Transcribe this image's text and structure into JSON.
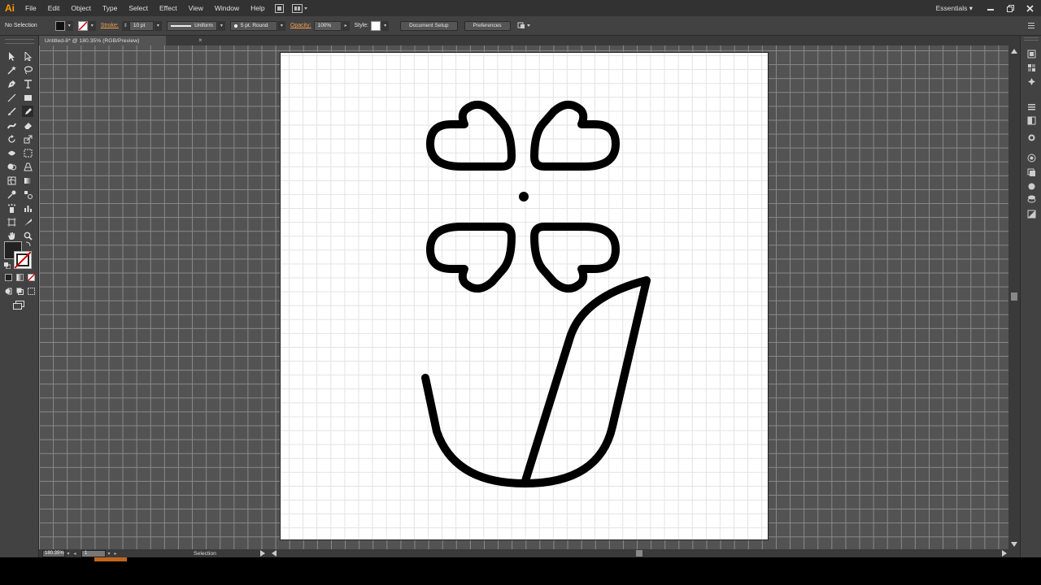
{
  "app": {
    "logo": "Ai",
    "accent": "#ff9a00"
  },
  "menu": [
    "File",
    "Edit",
    "Object",
    "Type",
    "Select",
    "Effect",
    "View",
    "Window",
    "Help"
  ],
  "menu_icons": [
    "bridge-icon",
    "arrange-documents-icon"
  ],
  "workspace": {
    "label": "Essentials",
    "arrow": "▾"
  },
  "window_controls": [
    "minimize-icon",
    "restore-icon",
    "close-icon"
  ],
  "control": {
    "selection_label": "No Selection",
    "stroke_label": "Stroke:",
    "stroke_weight": "10 pt",
    "stroke_profile": "Uniform",
    "brush": "5 pt. Round",
    "opacity_label": "Opacity:",
    "opacity_value": "100%",
    "style_label": "Style:",
    "document_setup": "Document Setup",
    "preferences": "Preferences",
    "link_color": "#f0a050"
  },
  "document": {
    "tab_title": "Untitled-8* @ 180.35% (RGB/Preview)",
    "tab_close": "×"
  },
  "tools": [
    "selection-tool-icon",
    "direct-selection-tool-icon",
    "magic-wand-tool-icon",
    "lasso-tool-icon",
    "pen-tool-icon",
    "type-tool-icon",
    "line-segment-tool-icon",
    "rectangle-tool-icon",
    "paintbrush-tool-icon",
    "pencil-tool-icon",
    "blob-brush-tool-icon",
    "eraser-tool-icon",
    "rotate-tool-icon",
    "scale-tool-icon",
    "width-tool-icon",
    "free-transform-tool-icon",
    "shape-builder-tool-icon",
    "perspective-grid-tool-icon",
    "mesh-tool-icon",
    "gradient-tool-icon",
    "eyedropper-tool-icon",
    "blend-tool-icon",
    "symbol-sprayer-tool-icon",
    "column-graph-tool-icon",
    "artboard-tool-icon",
    "slice-tool-icon",
    "hand-tool-icon",
    "zoom-tool-icon"
  ],
  "panels": [
    "color-panel-icon",
    "color-guide-panel-icon",
    "swatches-panel-icon",
    "brushes-panel-icon",
    "symbols-panel-icon",
    "stroke-panel-icon",
    "gradient-panel-icon",
    "transparency-panel-icon",
    "appearance-panel-icon",
    "graphic-styles-panel-icon",
    "layers-panel-icon",
    "artboards-panel-icon"
  ],
  "status": {
    "zoom": "180.35%",
    "page": "1",
    "text": "Selection"
  }
}
